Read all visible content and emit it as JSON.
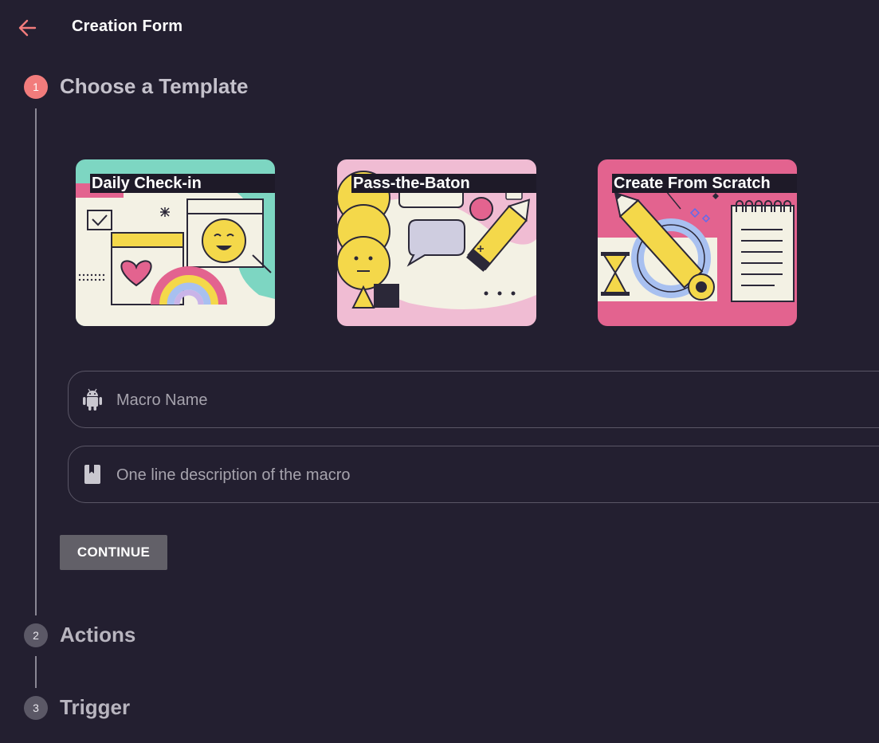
{
  "header": {
    "title": "Creation Form",
    "back_icon": "arrow-left-icon",
    "back_color": "#f27c7c"
  },
  "steps": [
    {
      "number": "1",
      "title": "Choose a Template",
      "state": "active"
    },
    {
      "number": "2",
      "title": "Actions",
      "state": "inactive"
    },
    {
      "number": "3",
      "title": "Trigger",
      "state": "inactive"
    }
  ],
  "templates": [
    {
      "label": "Daily Check-in",
      "accent": "#7dd6c2"
    },
    {
      "label": "Pass-the-Baton",
      "accent": "#f0bcd3"
    },
    {
      "label": "Create From Scratch",
      "accent": "#e3638f"
    }
  ],
  "form": {
    "macro_name": {
      "placeholder": "Macro Name",
      "value": "",
      "icon": "android-icon"
    },
    "description": {
      "placeholder": "One line description of the macro",
      "value": "",
      "icon": "bookmark-book-icon"
    }
  },
  "actions": {
    "continue_label": "CONTINUE"
  },
  "colors": {
    "background": "#231f30",
    "step_active": "#f27c7c",
    "step_inactive": "#5b5866",
    "button": "#626068"
  }
}
